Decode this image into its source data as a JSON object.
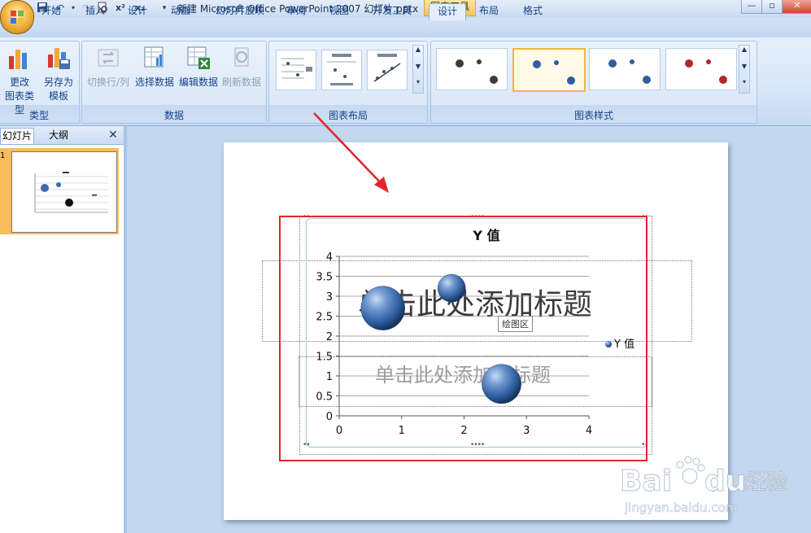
{
  "window": {
    "title": "新建 Microsoft Office PowerPoint 2007 幻灯片.pptx",
    "contextual_tab": "图表工具"
  },
  "tabs": [
    "开始",
    "插入",
    "设计",
    "动画",
    "幻灯片放映",
    "审阅",
    "视图",
    "开发工具",
    "设计",
    "布局",
    "格式"
  ],
  "active_tab_index": 8,
  "ribbon": {
    "type_group": {
      "label": "类型",
      "change_type": [
        "更改",
        "图表类型"
      ],
      "save_template": [
        "另存为",
        "模板"
      ]
    },
    "data_group": {
      "label": "数据",
      "switch_row_col": "切换行/列",
      "select_data": "选择数据",
      "edit_data": "编辑数据",
      "refresh_data": "刷新数据"
    },
    "layout_group": {
      "label": "图表布局"
    },
    "style_group": {
      "label": "图表样式",
      "styles": [
        {
          "colors": [
            "#3c3c3c",
            "#3c3c3c",
            "#3c3c3c"
          ]
        },
        {
          "colors": [
            "#2e5e9e",
            "#2e5e9e",
            "#2e5e9e"
          ]
        },
        {
          "colors": [
            "#2e5e9e",
            "#2e5e9e",
            "#2e5e9e"
          ]
        },
        {
          "colors": [
            "#b02828",
            "#b02828",
            "#b02828"
          ]
        }
      ],
      "selected_index": 1
    }
  },
  "left_pane": {
    "tab_slides": "幻灯片",
    "tab_outline": "大纲",
    "slide_number": "1"
  },
  "slide": {
    "title_placeholder": "单击此处添加标题",
    "subtitle_placeholder": "单击此处添加副标题",
    "plot_area_tooltip": "绘图区"
  },
  "chart_data": {
    "type": "scatter",
    "title": "Y 值",
    "xlim": [
      0,
      4
    ],
    "ylim": [
      0,
      4
    ],
    "x_ticks": [
      "0",
      "1",
      "2",
      "3",
      "4"
    ],
    "y_ticks": [
      "0",
      "0.5",
      "1",
      "1.5",
      "2",
      "2.5",
      "3",
      "3.5",
      "4"
    ],
    "series": [
      {
        "name": "Y 值",
        "points": [
          {
            "x": 0.7,
            "y": 2.7,
            "size": 10
          },
          {
            "x": 1.8,
            "y": 3.2,
            "size": 4
          },
          {
            "x": 2.6,
            "y": 0.8,
            "size": 8
          }
        ],
        "color": "#2e5e9e"
      }
    ],
    "grid": true,
    "legend_position": "right"
  },
  "colors": {
    "accent_red": "#e2242d",
    "bubble_blue": "#2e5e9e"
  },
  "watermark": {
    "brand": "Bai",
    "brand2": "du",
    "cn": "经验",
    "url": "jingyan.baidu.com"
  }
}
